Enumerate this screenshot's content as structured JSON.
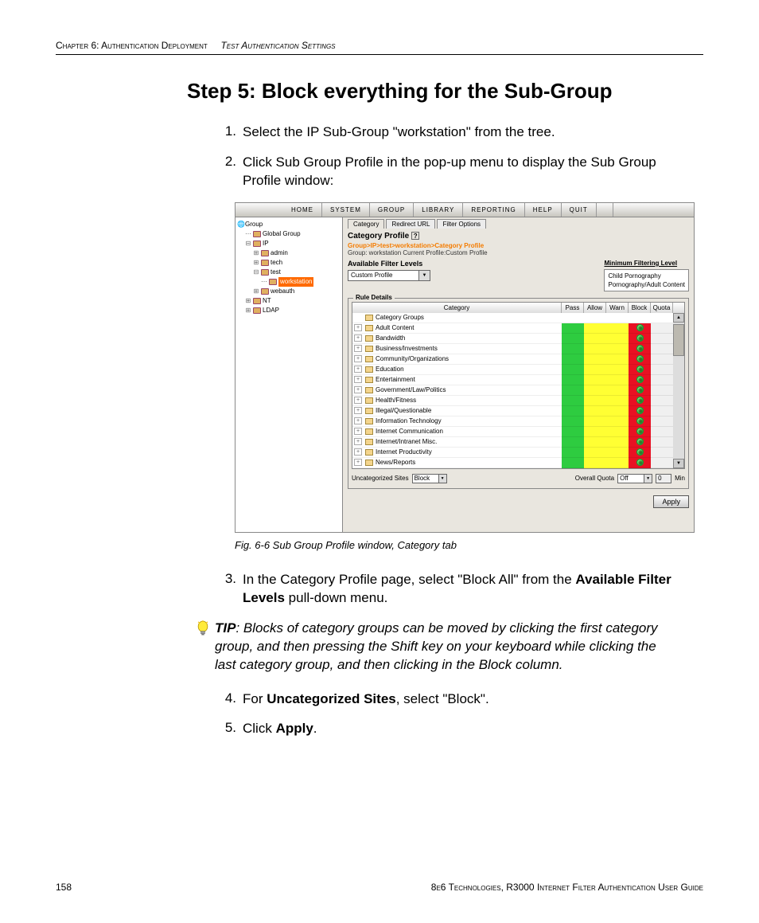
{
  "header": {
    "left_chapter": "Chapter 6: Authentication Deployment",
    "left_section": "Test Authentication Settings"
  },
  "step_title": "Step 5: Block everything for the Sub-Group",
  "list": {
    "i1": "Select the IP Sub-Group \"workstation\" from the tree.",
    "i2": "Click Sub Group Profile in the pop-up menu to display the Sub Group Profile window:",
    "i3_a": "In the Category Profile page, select \"Block All\" from the ",
    "i3_b": "Available Filter Levels",
    "i3_c": " pull-down menu.",
    "i4_a": "For ",
    "i4_b": "Uncategorized Sites",
    "i4_c": ", select \"Block\".",
    "i5_a": "Click ",
    "i5_b": "Apply",
    "i5_c": "."
  },
  "tip": {
    "label": "TIP",
    "body": ": Blocks of category groups can be moved by clicking the first category group, and then pressing the Shift key on your keyboard while clicking the last category group, and then clicking in the Block column."
  },
  "fig_caption": "Fig. 6-6  Sub Group Profile window, Category tab",
  "footer": {
    "page": "158",
    "right": "8e6 Technologies, R3000 Internet Filter Authentication User Guide"
  },
  "screenshot": {
    "menus": [
      "HOME",
      "SYSTEM",
      "GROUP",
      "LIBRARY",
      "REPORTING",
      "HELP",
      "QUIT"
    ],
    "tree": {
      "root": "Group",
      "nodes": [
        {
          "label": "Global Group",
          "indent": 1
        },
        {
          "label": "IP",
          "indent": 1
        },
        {
          "label": "admin",
          "indent": 2
        },
        {
          "label": "tech",
          "indent": 2
        },
        {
          "label": "test",
          "indent": 2
        },
        {
          "label": "workstation",
          "indent": 3,
          "selected": true
        },
        {
          "label": "webauth",
          "indent": 2
        },
        {
          "label": "NT",
          "indent": 1
        },
        {
          "label": "LDAP",
          "indent": 1
        }
      ]
    },
    "tabs": [
      "Category",
      "Redirect URL",
      "Filter Options"
    ],
    "cp_title": "Category Profile",
    "crumb": "Group>IP>test>workstation>Category Profile",
    "crumb_sub": "Group: workstation   Current Profile:Custom Profile",
    "afl_label": "Available Filter Levels",
    "afl_value": "Custom Profile",
    "mfl_title": "Minimum Filtering Level",
    "mfl_lines": [
      "Child Pornography",
      "Pornography/Adult Content"
    ],
    "rule_legend": "Rule Details",
    "cols": [
      "Category",
      "Pass",
      "Allow",
      "Warn",
      "Block",
      "Quota"
    ],
    "categories": [
      "Category Groups",
      "Adult Content",
      "Bandwidth",
      "Business/Investments",
      "Community/Organizations",
      "Education",
      "Entertainment",
      "Government/Law/Politics",
      "Health/Fitness",
      "Illegal/Questionable",
      "Information Technology",
      "Internet Communication",
      "Internet/Intranet Misc.",
      "Internet Productivity",
      "News/Reports"
    ],
    "uncat_label": "Uncategorized Sites",
    "uncat_value": "Block",
    "overall_quota_label": "Overall Quota",
    "overall_quota_value": "Off",
    "overall_quota_num": "0",
    "overall_quota_unit": "Min",
    "apply": "Apply"
  }
}
